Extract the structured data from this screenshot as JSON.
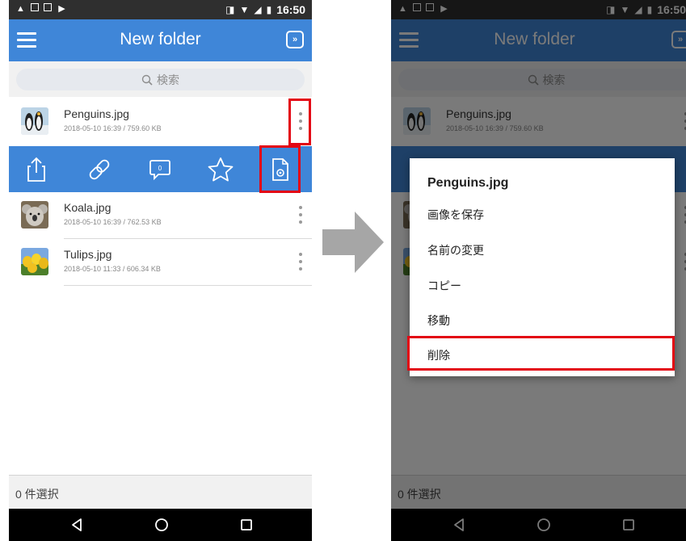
{
  "status": {
    "time": "16:50"
  },
  "appbar": {
    "title": "New folder",
    "action_icon": "chevron-double-down-icon"
  },
  "search": {
    "placeholder": "検索"
  },
  "files": [
    {
      "name": "Penguins.jpg",
      "meta": "2018-05-10 16:39 / 759.60 KB"
    },
    {
      "name": "Koala.jpg",
      "meta": "2018-05-10 16:39 / 762.53 KB"
    },
    {
      "name": "Tulips.jpg",
      "meta": "2018-05-10 11:33 / 606.34 KB"
    }
  ],
  "action_bar": {
    "comment_count": "0"
  },
  "footer": {
    "selection": "0 件選択"
  },
  "dialog": {
    "title": "Penguins.jpg",
    "items": [
      "画像を保存",
      "名前の変更",
      "コピー",
      "移動",
      "削除"
    ]
  },
  "colors": {
    "accent": "#3f86d8",
    "highlight": "#e30613",
    "statusbar": "#2f2f2f"
  }
}
